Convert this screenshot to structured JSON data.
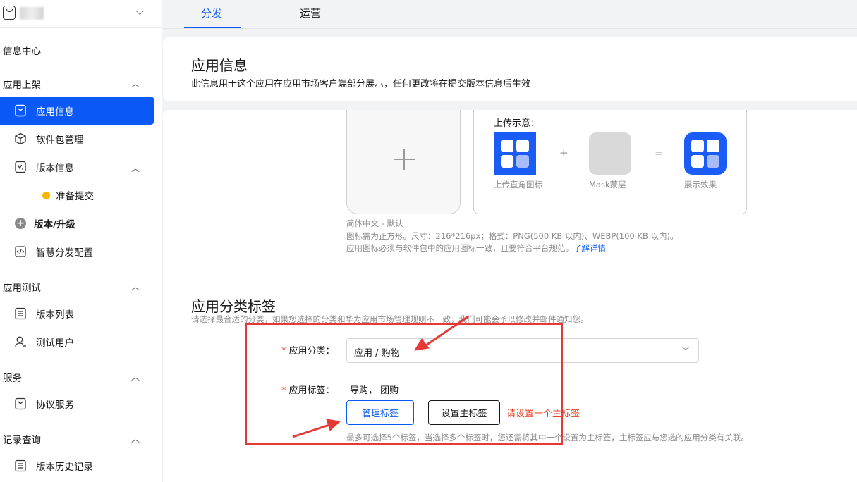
{
  "app": {
    "chevron": "⌵"
  },
  "sidebar": {
    "info_center": "信息中心",
    "sections": {
      "listing": "应用上架",
      "testing": "应用测试",
      "service": "服务",
      "records": "记录查询"
    },
    "items": {
      "app_info": "应用信息",
      "package_mgmt": "软件包管理",
      "version_info": "版本信息",
      "ready_submit": "准备提交",
      "version_upgrade": "版本/升级",
      "smart_dist": "智慧分发配置",
      "version_list": "版本列表",
      "test_users": "测试用户",
      "agreement": "协议服务",
      "version_history": "版本历史记录"
    }
  },
  "tabs": {
    "distribute": "分发",
    "operate": "运营"
  },
  "header": {
    "title": "应用信息",
    "desc": "此信息用于这个应用在应用市场客户端部分展示，任何更改将在提交版本信息后生效"
  },
  "icon_upload": {
    "demo_title": "上传示意：",
    "plus_op": "+",
    "eq_op": "=",
    "cap_square": "上传直角图标",
    "cap_mask": "Mask蒙层",
    "cap_result": "展示效果",
    "lang": "简体中文 - 默认",
    "req_line": "图标需为正方形。尺寸：216*216px；格式：PNG(500 KB 以内)、WEBP(100 KB 以内)。",
    "rule_line": "应用图标必须与软件包中的应用图标一致，且要符合平台规范。",
    "learn_more": "了解详情"
  },
  "category": {
    "title": "应用分类标签",
    "hint": "请选择最合适的分类，如果您选择的分类和华为应用市场管理规则不一致，我们可能会予以修改并邮件通知您。",
    "required_mark": "*",
    "category_label": "应用分类：",
    "category_value": "应用 / 购物",
    "tags_label": "应用标签：",
    "tags_value": "导购， 团购",
    "manage_tags": "管理标签",
    "set_main_tag": "设置主标签",
    "error": "请设置一个主标签",
    "tags_hint": "最多可选择5个标签，当选择多个标签时，您还需将其中一个设置为主标签，主标签应与您选的应用分类有关联。"
  },
  "annotation_color": "#e53935",
  "accent_color": "#0a59f7"
}
